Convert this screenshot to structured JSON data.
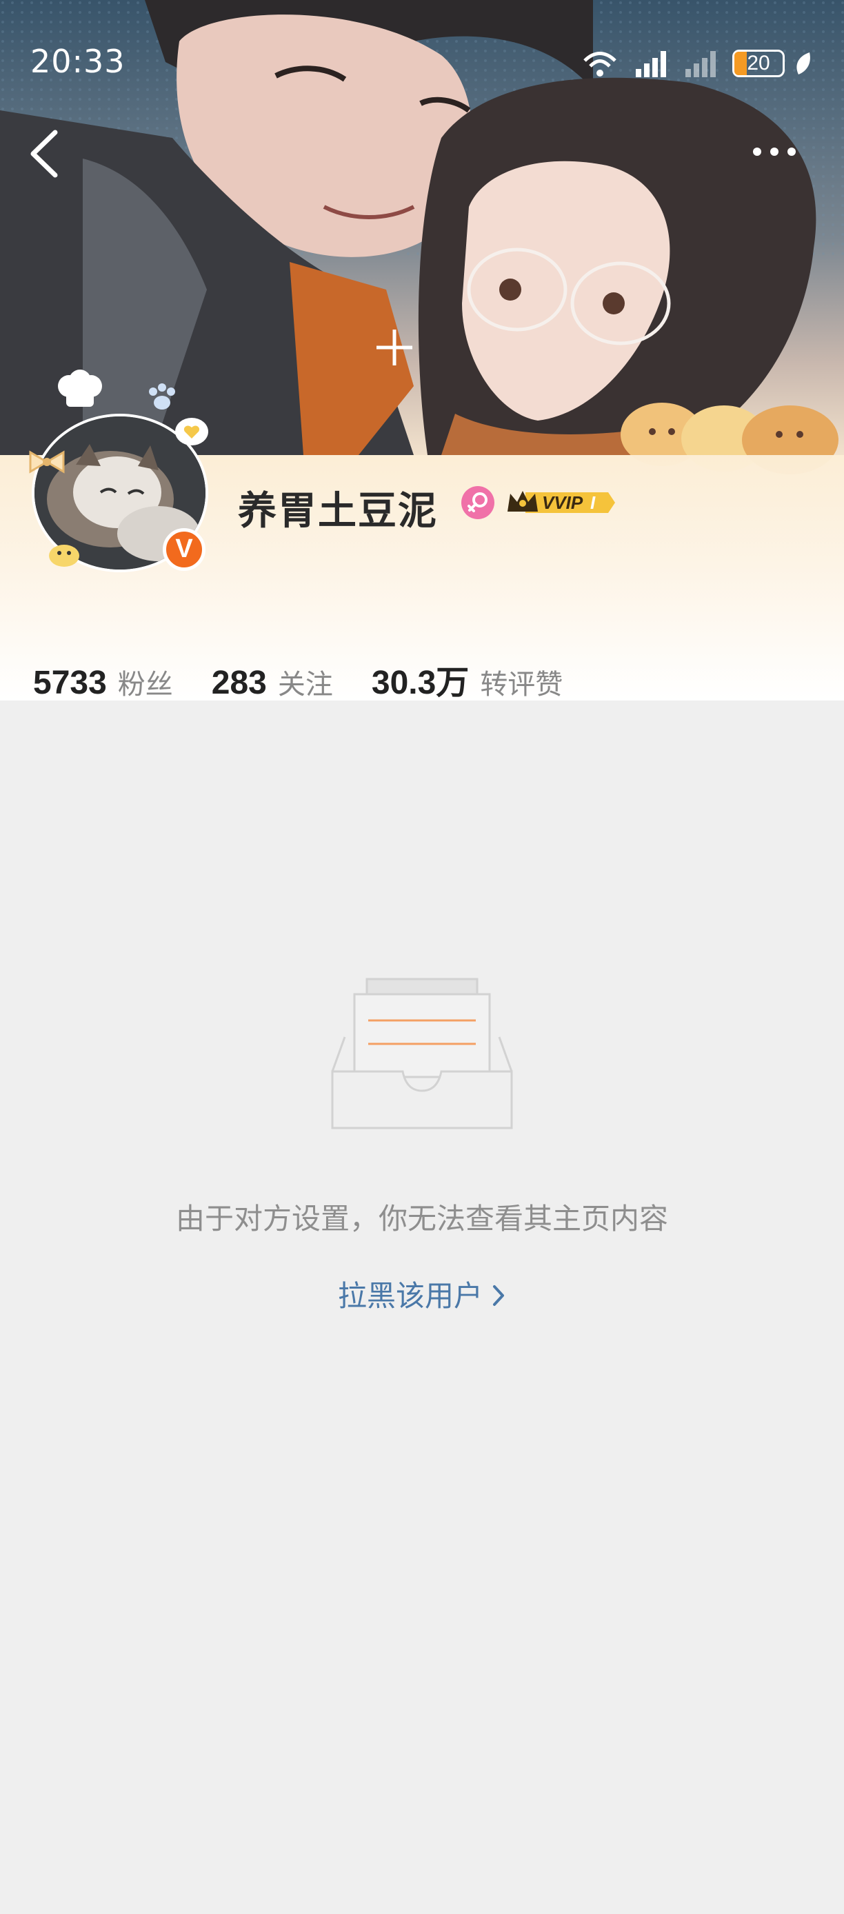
{
  "status_bar": {
    "time": "20:33",
    "battery_level": "20",
    "icons": [
      "wifi-icon",
      "signal-icon",
      "signal-2-icon",
      "battery-icon",
      "leaf-icon"
    ]
  },
  "nav": {
    "back_icon": "chevron-left-icon",
    "more_icon": "more-horizontal-icon"
  },
  "profile": {
    "username": "养胃土豆泥",
    "gender": "female",
    "verified_badge": "V",
    "vip_label": "VVIP",
    "vip_level": "I",
    "colors": {
      "verified": "#f26a1d",
      "gender": "#f071a8",
      "vip_gold": "#f5c33b"
    }
  },
  "stats": [
    {
      "value": "5733",
      "label": "粉丝"
    },
    {
      "value": "283",
      "label": "关注"
    },
    {
      "value": "30.3万",
      "label": "转评赞"
    }
  ],
  "empty_state": {
    "message": "由于对方设置，你无法查看其主页内容",
    "action_label": "拉黑该用户",
    "action_color": "#4a78a8"
  }
}
